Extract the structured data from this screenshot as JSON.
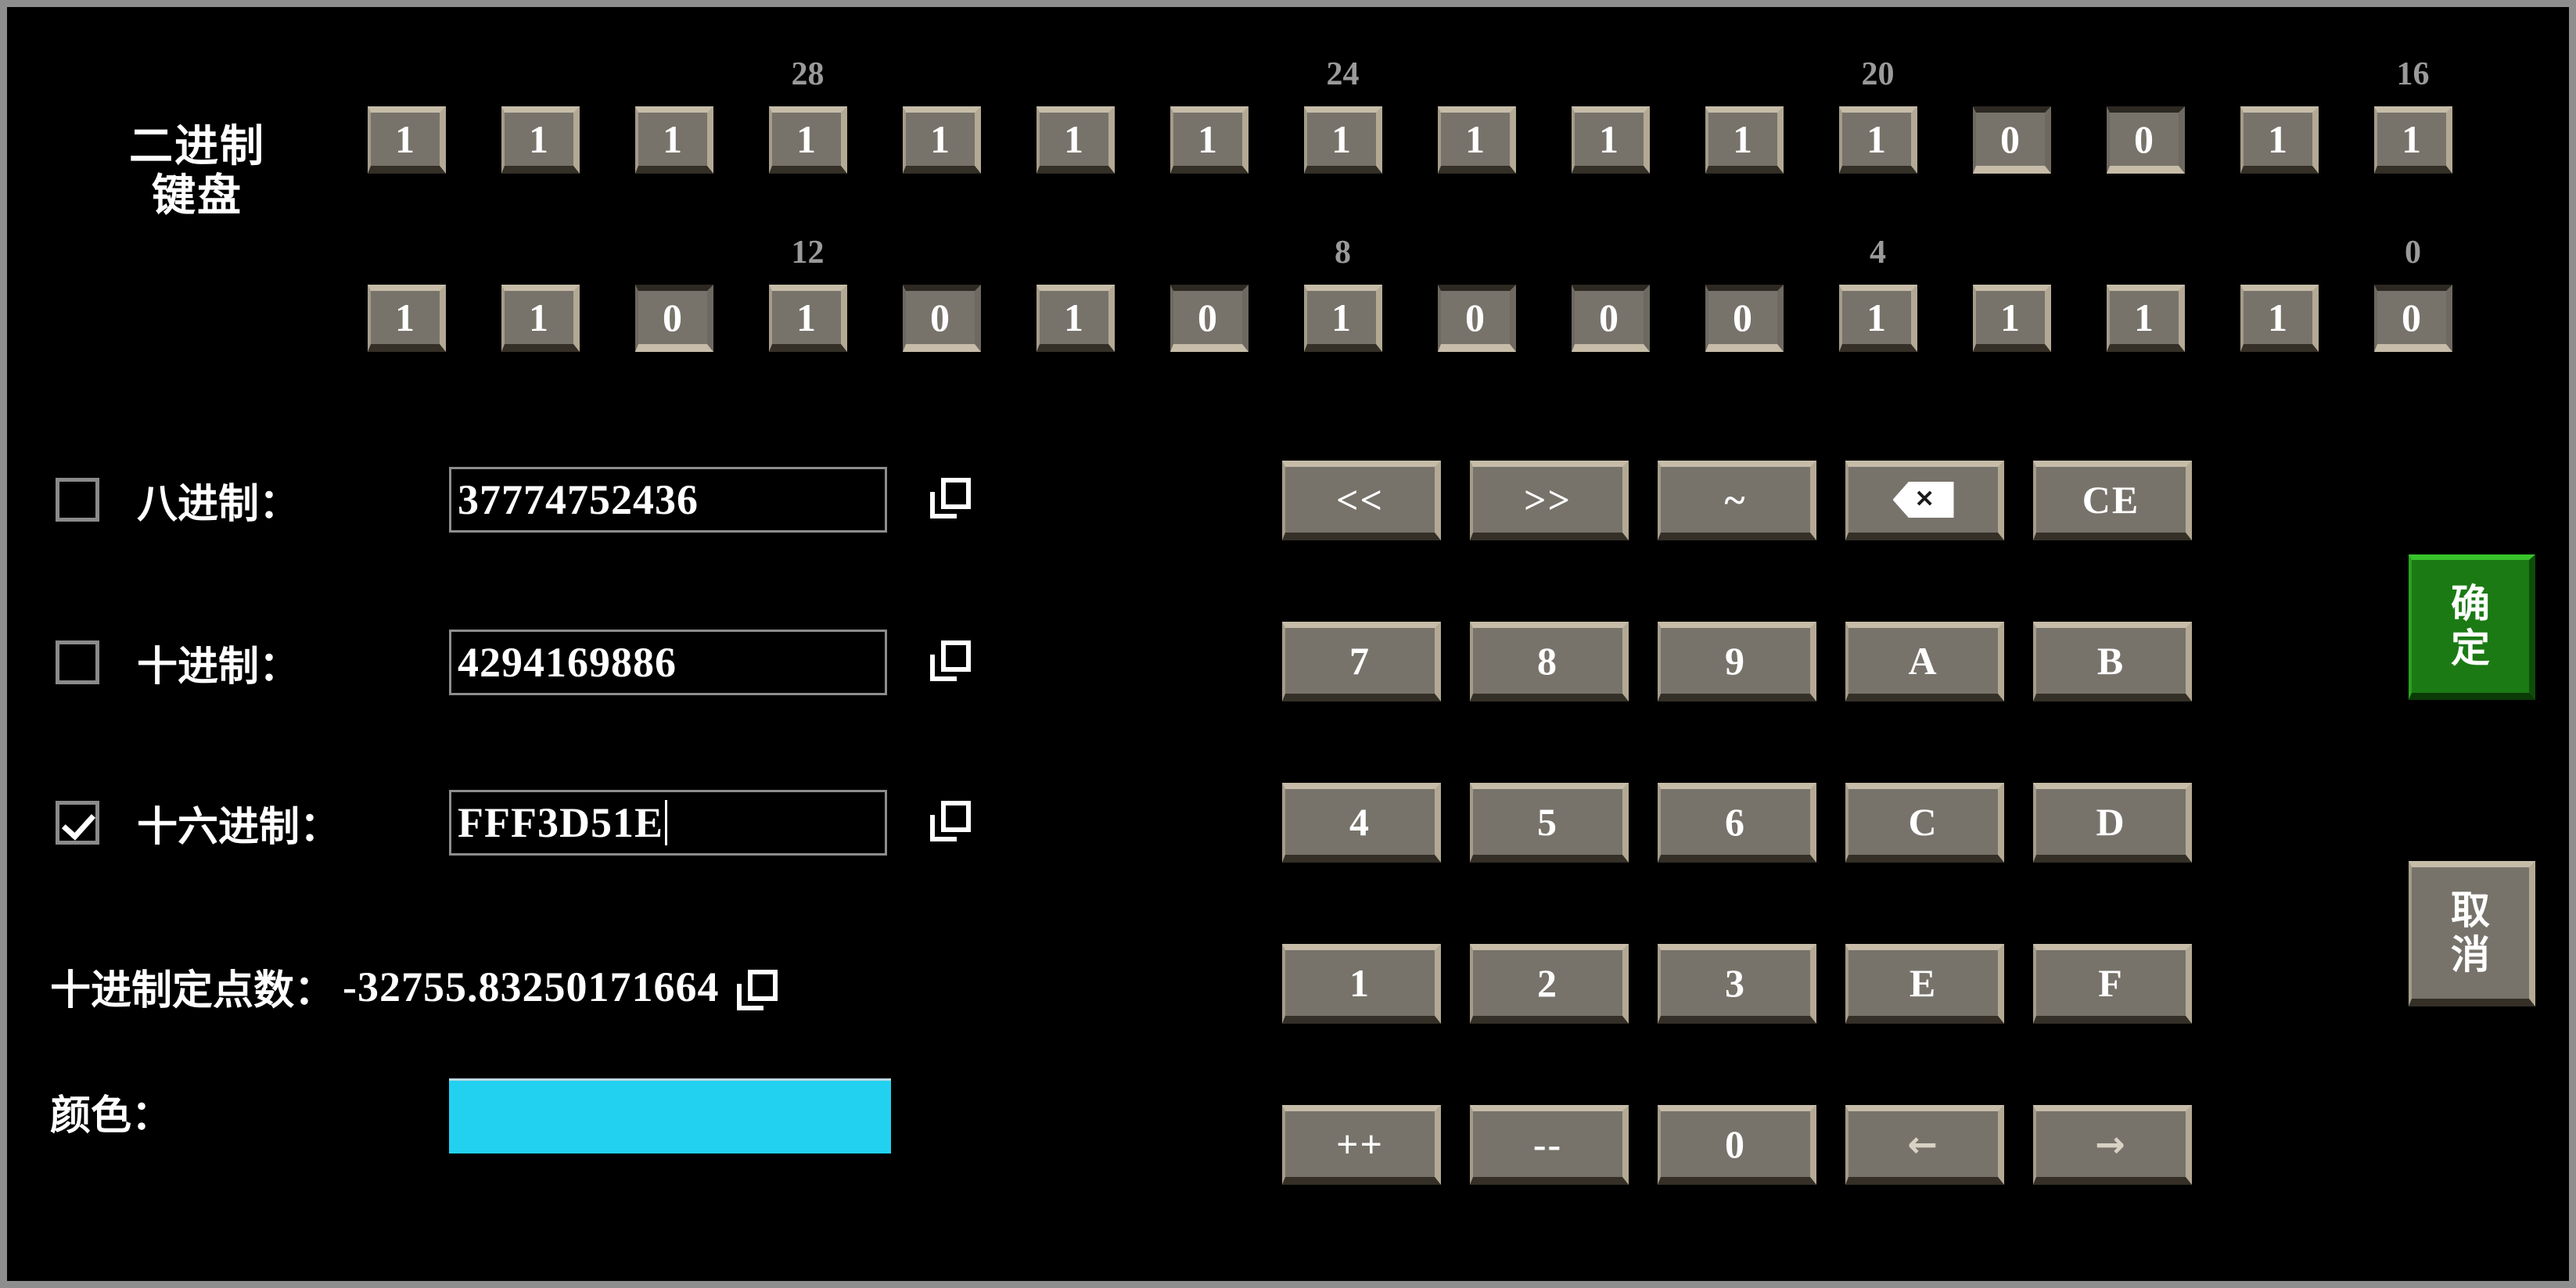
{
  "binary_keyboard": {
    "title": "二进制\n键盘",
    "title_line1": "二进制",
    "title_line2": "键盘",
    "row1": {
      "bits": [
        "1",
        "1",
        "1",
        "1",
        "1",
        "1",
        "1",
        "1",
        "1",
        "1",
        "1",
        "1",
        "0",
        "0",
        "1",
        "1"
      ],
      "index_labels": [
        "",
        "",
        "",
        "28",
        "",
        "",
        "",
        "24",
        "",
        "",
        "",
        "20",
        "",
        "",
        "",
        "16"
      ]
    },
    "row2": {
      "bits": [
        "1",
        "1",
        "0",
        "1",
        "0",
        "1",
        "0",
        "1",
        "0",
        "0",
        "0",
        "1",
        "1",
        "1",
        "1",
        "0"
      ],
      "index_labels": [
        "",
        "",
        "",
        "12",
        "",
        "",
        "",
        "8",
        "",
        "",
        "",
        "4",
        "",
        "",
        "",
        "0"
      ]
    }
  },
  "fields": {
    "octal": {
      "label": "八进制：",
      "checked": false,
      "value": "37774752436",
      "copy_icon": "copy-icon"
    },
    "decimal": {
      "label": "十进制：",
      "checked": false,
      "value": "4294169886",
      "copy_icon": "copy-icon"
    },
    "hex": {
      "label": "十六进制：",
      "checked": true,
      "value": "FFF3D51E",
      "copy_icon": "copy-icon"
    },
    "fixed_point": {
      "label": "十进制定点数：",
      "value": "-32755.83250171664",
      "copy_icon": "copy-icon"
    },
    "color": {
      "label": "颜色：",
      "value": "#22D1F0"
    }
  },
  "keypad": {
    "rows": [
      [
        {
          "id": "shift-left",
          "label": "<<"
        },
        {
          "id": "shift-right",
          "label": ">>"
        },
        {
          "id": "bitwise-not",
          "label": "~"
        },
        {
          "id": "backspace",
          "label": "",
          "icon": "backspace-icon"
        },
        {
          "id": "clear-entry",
          "label": "CE"
        }
      ],
      [
        {
          "id": "key-7",
          "label": "7"
        },
        {
          "id": "key-8",
          "label": "8"
        },
        {
          "id": "key-9",
          "label": "9"
        },
        {
          "id": "key-a",
          "label": "A"
        },
        {
          "id": "key-b",
          "label": "B"
        }
      ],
      [
        {
          "id": "key-4",
          "label": "4"
        },
        {
          "id": "key-5",
          "label": "5"
        },
        {
          "id": "key-6",
          "label": "6"
        },
        {
          "id": "key-c",
          "label": "C"
        },
        {
          "id": "key-d",
          "label": "D"
        }
      ],
      [
        {
          "id": "key-1",
          "label": "1"
        },
        {
          "id": "key-2",
          "label": "2"
        },
        {
          "id": "key-3",
          "label": "3"
        },
        {
          "id": "key-e",
          "label": "E"
        },
        {
          "id": "key-f",
          "label": "F"
        }
      ],
      [
        {
          "id": "increment",
          "label": "++"
        },
        {
          "id": "decrement",
          "label": "--"
        },
        {
          "id": "key-0",
          "label": "0"
        },
        {
          "id": "cursor-left",
          "label": "←",
          "icon": "arrow-left-icon"
        },
        {
          "id": "cursor-right",
          "label": "→",
          "icon": "arrow-right-icon"
        }
      ]
    ]
  },
  "actions": {
    "confirm": {
      "label": "确定",
      "line1": "确",
      "line2": "定",
      "color": "#1B7A14"
    },
    "cancel": {
      "label": "取消",
      "line1": "取",
      "line2": "消",
      "color": "#77736B"
    }
  }
}
